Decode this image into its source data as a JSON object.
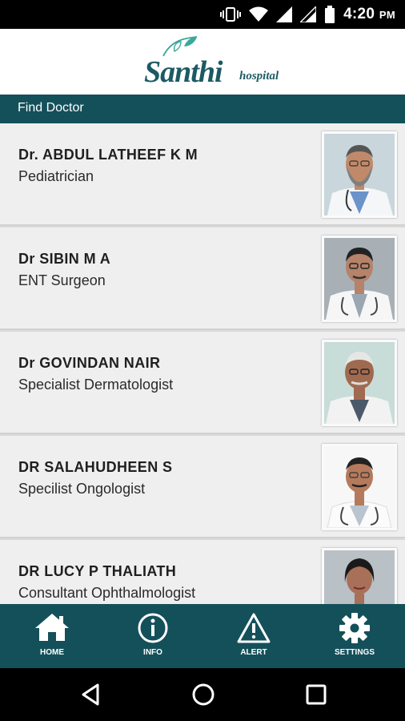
{
  "status_bar": {
    "time": "4:20",
    "ampm": "PM"
  },
  "header": {
    "logo_name": "Santhi",
    "logo_sub": "hospital"
  },
  "section": {
    "title": "Find Doctor"
  },
  "doctors": [
    {
      "name": "Dr. ABDUL LATHEEF K M",
      "specialty": "Pediatrician"
    },
    {
      "name": "Dr SIBIN M A",
      "specialty": "ENT Surgeon"
    },
    {
      "name": "Dr GOVINDAN NAIR",
      "specialty": "Specialist Dermatologist"
    },
    {
      "name": "DR SALAHUDHEEN S",
      "specialty": "Specilist Ongologist"
    },
    {
      "name": "DR LUCY P THALIATH",
      "specialty": "Consultant Ophthalmologist"
    }
  ],
  "bottom_nav": [
    {
      "label": "HOME",
      "icon": "home-icon"
    },
    {
      "label": "INFO",
      "icon": "info-icon"
    },
    {
      "label": "ALERT",
      "icon": "alert-icon"
    },
    {
      "label": "SETTINGS",
      "icon": "settings-icon"
    }
  ],
  "colors": {
    "brand": "#14505a",
    "card": "#efefef"
  }
}
